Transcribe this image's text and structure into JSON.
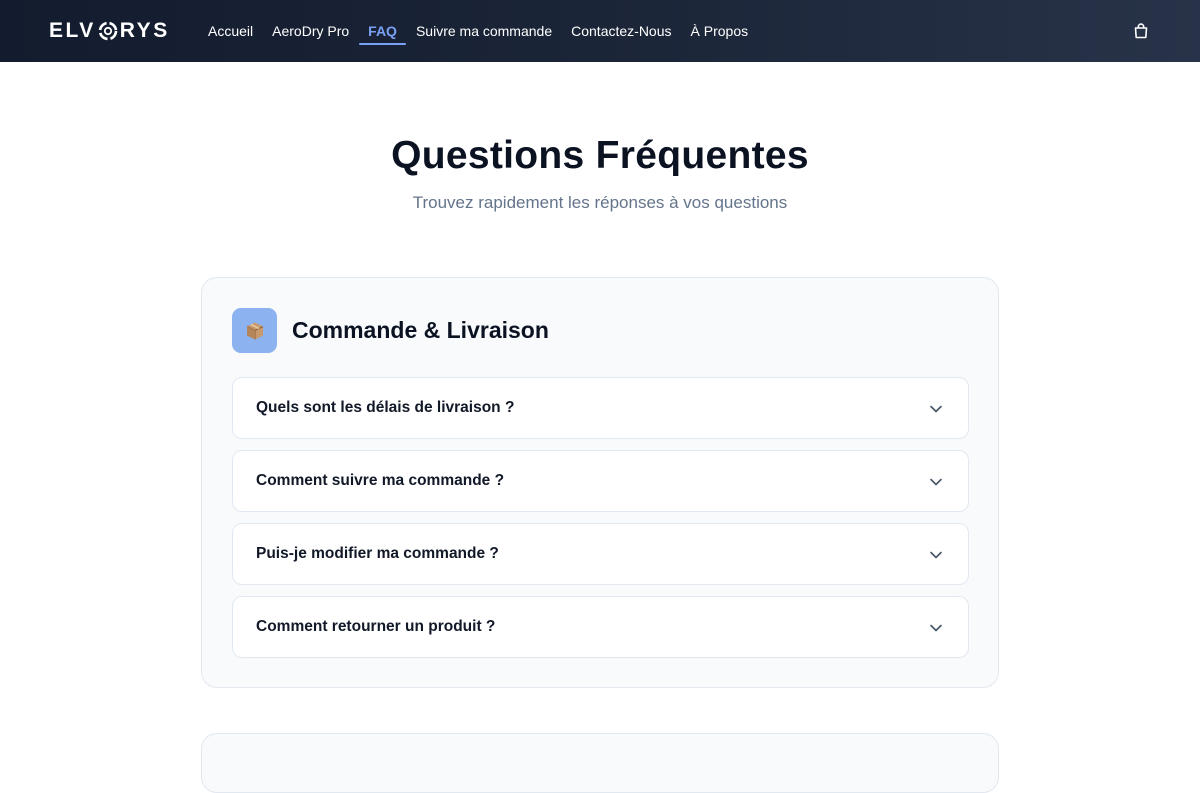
{
  "header": {
    "logo_text_left": "ELV",
    "logo_text_right": "RYS",
    "nav": [
      {
        "label": "Accueil",
        "active": false
      },
      {
        "label": "AeroDry Pro",
        "active": false
      },
      {
        "label": "FAQ",
        "active": true
      },
      {
        "label": "Suivre ma commande",
        "active": false
      },
      {
        "label": "Contactez-Nous",
        "active": false
      },
      {
        "label": "À Propos",
        "active": false
      }
    ],
    "cart_icon": "shopping-bag-icon",
    "accent_color": "#7aa2f4"
  },
  "hero": {
    "title": "Questions Fréquentes",
    "subtitle": "Trouvez rapidement les réponses à vos questions"
  },
  "faq": {
    "category": {
      "icon": "package-icon",
      "title": "Commande & Livraison"
    },
    "questions": [
      "Quels sont les délais de livraison ?",
      "Comment suivre ma commande ?",
      "Puis-je modifier ma commande ?",
      "Comment retourner un produit ?"
    ]
  }
}
